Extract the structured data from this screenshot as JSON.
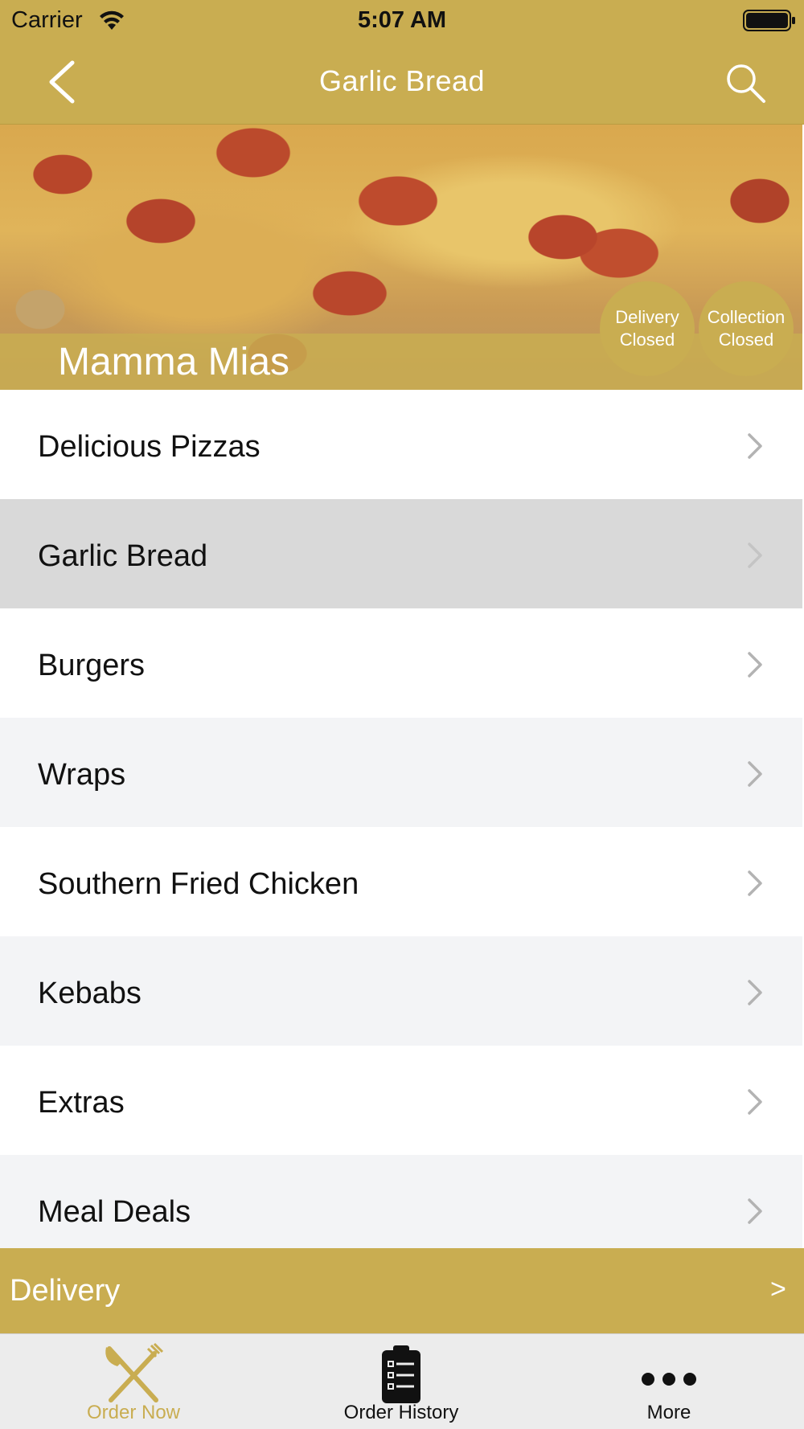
{
  "status_bar": {
    "carrier": "Carrier",
    "time": "5:07 AM"
  },
  "nav": {
    "title": "Garlic Bread",
    "back_icon": "chevron-left-icon",
    "search_icon": "search-icon"
  },
  "hero": {
    "restaurant_name": "Mamma Mias",
    "delivery_status": {
      "line1": "Delivery",
      "line2": "Closed"
    },
    "collection_status": {
      "line1": "Collection",
      "line2": "Closed"
    }
  },
  "menu": {
    "selected": "Garlic Bread",
    "items": [
      {
        "label": "Delicious Pizzas"
      },
      {
        "label": "Garlic Bread"
      },
      {
        "label": "Burgers"
      },
      {
        "label": "Wraps"
      },
      {
        "label": "Southern Fried Chicken"
      },
      {
        "label": "Kebabs"
      },
      {
        "label": "Extras"
      },
      {
        "label": "Meal Deals"
      }
    ]
  },
  "order_bar": {
    "label": "Delivery",
    "arrow": ">"
  },
  "tabs": [
    {
      "label": "Order Now",
      "icon": "fork-knife-icon",
      "active": true
    },
    {
      "label": "Order History",
      "icon": "clipboard-icon",
      "active": false
    },
    {
      "label": "More",
      "icon": "more-dots-icon",
      "active": false
    }
  ],
  "colors": {
    "accent": "#c9ad51",
    "selected_row": "#d9d9d9",
    "alt_row": "#f3f4f6"
  }
}
